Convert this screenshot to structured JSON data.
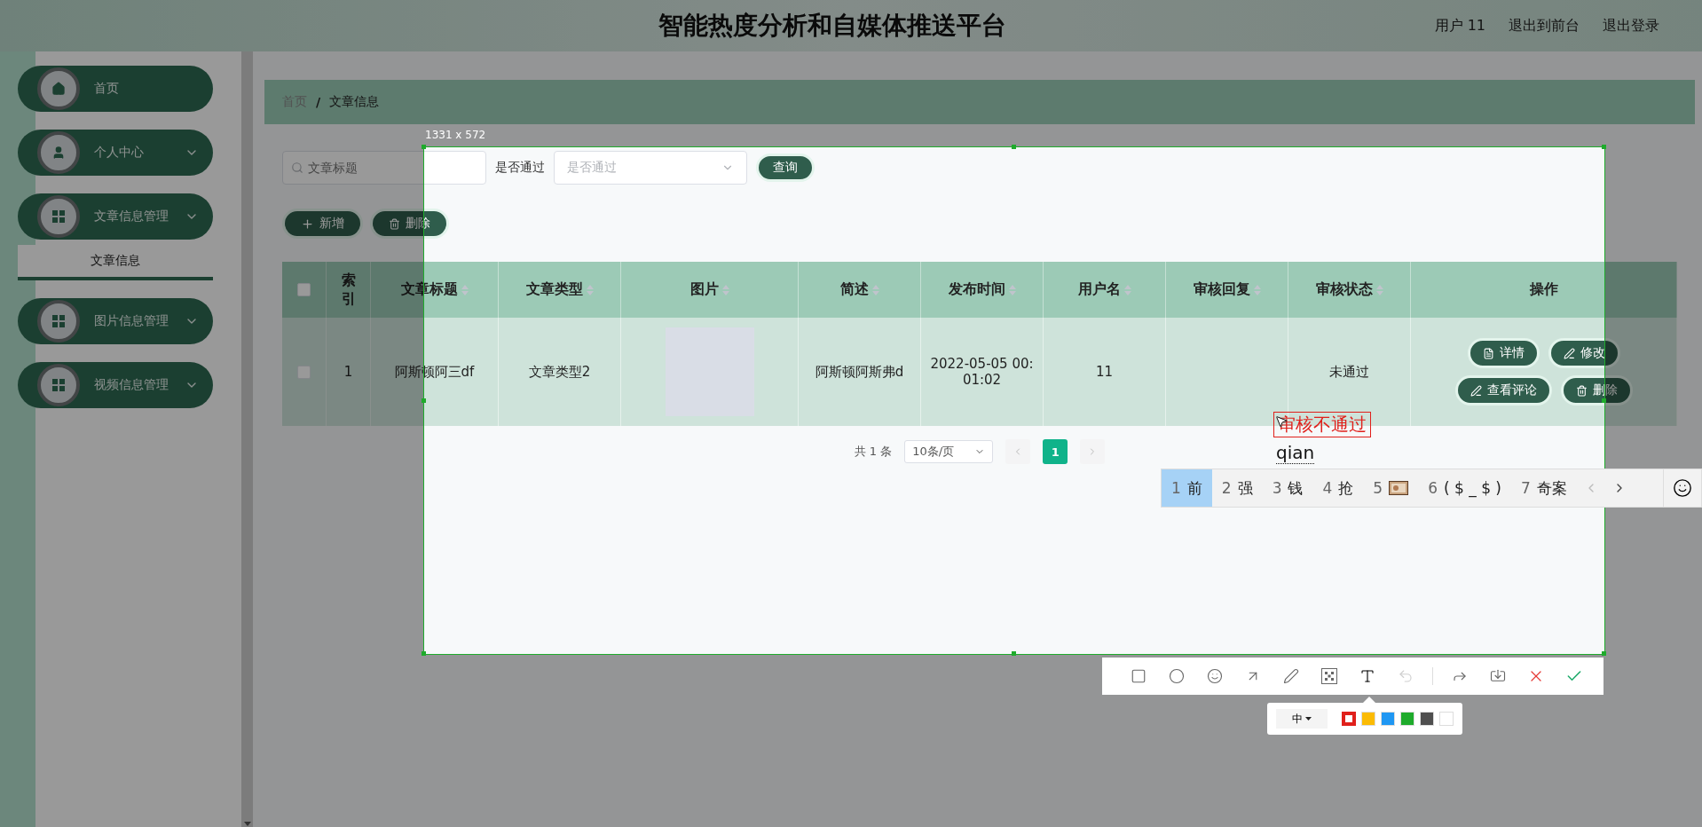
{
  "header": {
    "title": "智能热度分析和自媒体推送平台",
    "links": [
      "用户 11",
      "退出到前台",
      "退出登录"
    ]
  },
  "sidebar": {
    "items": [
      {
        "label": "首页",
        "kind": "home"
      },
      {
        "label": "个人中心",
        "kind": "user"
      },
      {
        "label": "文章信息管理",
        "kind": "grid",
        "children": [
          {
            "label": "文章信息",
            "selected": true
          }
        ]
      },
      {
        "label": "图片信息管理",
        "kind": "grid"
      },
      {
        "label": "视频信息管理",
        "kind": "grid"
      }
    ]
  },
  "breadcrumb": {
    "items": [
      "首页",
      "文章信息"
    ],
    "separator": "/"
  },
  "search": {
    "placeholder": "文章标题"
  },
  "filter": {
    "label": "是否通过",
    "placeholder": "是否通过"
  },
  "query_button": "查询",
  "actions": [
    {
      "label": "新增",
      "kind": "plus"
    },
    {
      "label": "删除",
      "kind": "trash"
    }
  ],
  "table": {
    "select_all": false,
    "columns": [
      {
        "label": "索引",
        "sortable": false
      },
      {
        "label": "文章标题",
        "sortable": true
      },
      {
        "label": "文章类型",
        "sortable": true
      },
      {
        "label": "图片",
        "sortable": true
      },
      {
        "label": "简述",
        "sortable": true
      },
      {
        "label": "发布时间",
        "sortable": true
      },
      {
        "label": "用户名",
        "sortable": true
      },
      {
        "label": "审核回复",
        "sortable": true
      },
      {
        "label": "审核状态",
        "sortable": true
      },
      {
        "label": "操作",
        "sortable": false
      }
    ],
    "rows": [
      {
        "checked": false,
        "index": "1",
        "title": "阿斯顿阿三df",
        "type": "文章类型2",
        "summary": "阿斯顿阿斯弗d",
        "time": "2022-05-05 00:01:02",
        "user": "11",
        "status": "未通过",
        "buttons": [
          {
            "label": "详情",
            "kind": "doc"
          },
          {
            "label": "修改",
            "kind": "edit"
          },
          {
            "label": "查看评论",
            "kind": "edit"
          },
          {
            "label": "删除",
            "kind": "trash"
          }
        ]
      }
    ]
  },
  "pagination": {
    "total": "共 1 条",
    "page_size": "10条/页",
    "pages": [
      {
        "label": "1",
        "selected": true
      }
    ]
  },
  "capture": {
    "size_label": "1331 x 572",
    "text_annotation": "审核不通过",
    "ime": {
      "composition": "qian",
      "candidates": [
        {
          "number": "1",
          "text": "前",
          "kind": "text",
          "selected": true
        },
        {
          "number": "2",
          "text": "强",
          "kind": "text",
          "selected": false
        },
        {
          "number": "3",
          "text": "钱",
          "kind": "text",
          "selected": false
        },
        {
          "number": "4",
          "text": "抢",
          "kind": "text",
          "selected": false
        },
        {
          "number": "5",
          "kind": "image",
          "selected": false
        },
        {
          "number": "6",
          "text": "( $ _ $ )",
          "kind": "text",
          "selected": false
        },
        {
          "number": "7",
          "text": "奇案",
          "kind": "text",
          "selected": false
        }
      ]
    },
    "tools": [
      {
        "kind": "rect",
        "selected": false,
        "disabled": false
      },
      {
        "kind": "ellipse",
        "selected": false,
        "disabled": false
      },
      {
        "kind": "emoji",
        "selected": false,
        "disabled": false
      },
      {
        "kind": "arrow",
        "selected": false,
        "disabled": false
      },
      {
        "kind": "pen",
        "selected": false,
        "disabled": false
      },
      {
        "kind": "mosaic",
        "selected": false,
        "disabled": false
      },
      {
        "kind": "text",
        "selected": true,
        "disabled": false
      },
      {
        "kind": "undo",
        "selected": false,
        "disabled": true
      }
    ],
    "commands": [
      {
        "kind": "share"
      },
      {
        "kind": "save"
      },
      {
        "kind": "cancel"
      },
      {
        "kind": "confirm"
      }
    ],
    "font_size": "中",
    "colors": [
      {
        "color": "#e0201b",
        "selected": true
      },
      {
        "color": "#fbbb04",
        "selected": false
      },
      {
        "color": "#1f97f3",
        "selected": false
      },
      {
        "color": "#1fab2c",
        "selected": false
      },
      {
        "color": "#4f4f4f",
        "selected": false
      },
      {
        "color": "#ffffff",
        "selected": false
      }
    ]
  }
}
